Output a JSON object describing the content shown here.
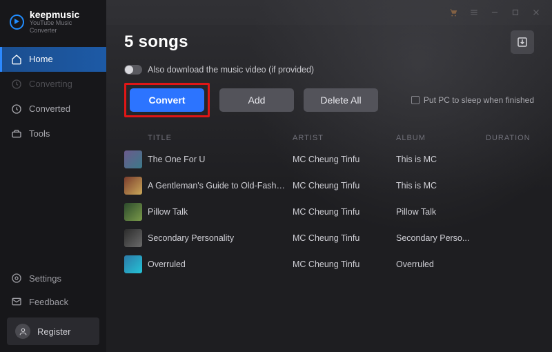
{
  "brand": {
    "name": "keepmusic",
    "sub": "YouTube Music Converter"
  },
  "sidebar": {
    "items": [
      {
        "label": "Home"
      },
      {
        "label": "Converting"
      },
      {
        "label": "Converted"
      },
      {
        "label": "Tools"
      }
    ],
    "secondary": [
      {
        "label": "Settings"
      },
      {
        "label": "Feedback"
      }
    ],
    "register": "Register"
  },
  "header": {
    "title": "5 songs",
    "download_video_label": "Also download the music video (if provided)"
  },
  "buttons": {
    "convert": "Convert",
    "add": "Add",
    "delete_all": "Delete All"
  },
  "sleep_label": "Put PC to sleep when finished",
  "columns": {
    "title": "TITLE",
    "artist": "ARTIST",
    "album": "ALBUM",
    "duration": "DURATION"
  },
  "tracks": [
    {
      "title": "The One For U",
      "artist": "MC Cheung Tinfu",
      "album": "This is MC",
      "duration": ""
    },
    {
      "title": "A Gentleman's Guide to Old-Fashioned D...",
      "artist": "MC Cheung Tinfu",
      "album": "This is MC",
      "duration": ""
    },
    {
      "title": "Pillow Talk",
      "artist": "MC Cheung Tinfu",
      "album": "Pillow Talk",
      "duration": ""
    },
    {
      "title": "Secondary Personality",
      "artist": "MC Cheung Tinfu",
      "album": "Secondary Perso...",
      "duration": ""
    },
    {
      "title": "Overruled",
      "artist": "MC Cheung Tinfu",
      "album": "Overruled",
      "duration": ""
    }
  ]
}
